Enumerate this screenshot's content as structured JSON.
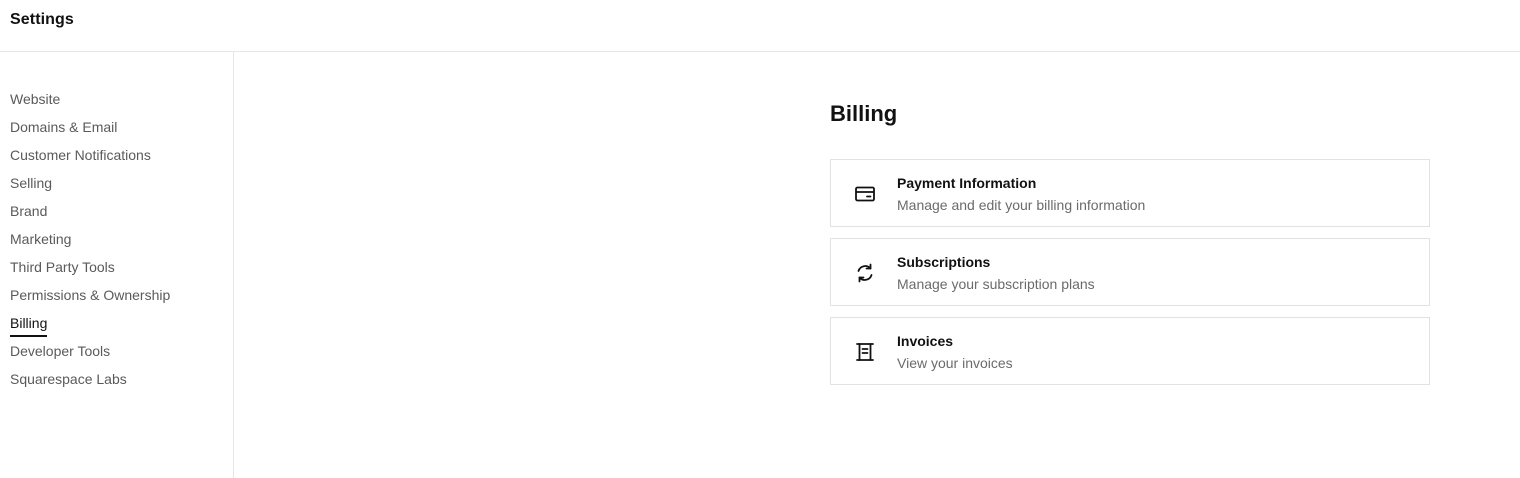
{
  "header": {
    "title": "Settings"
  },
  "sidebar": {
    "items": [
      {
        "label": "Website"
      },
      {
        "label": "Domains & Email"
      },
      {
        "label": "Customer Notifications"
      },
      {
        "label": "Selling"
      },
      {
        "label": "Brand"
      },
      {
        "label": "Marketing"
      },
      {
        "label": "Third Party Tools"
      },
      {
        "label": "Permissions & Ownership"
      },
      {
        "label": "Billing",
        "active": true
      },
      {
        "label": "Developer Tools"
      },
      {
        "label": "Squarespace Labs"
      }
    ]
  },
  "main": {
    "heading": "Billing",
    "cards": [
      {
        "icon": "credit-card-icon",
        "title": "Payment Information",
        "description": "Manage and edit your billing information"
      },
      {
        "icon": "refresh-icon",
        "title": "Subscriptions",
        "description": "Manage your subscription plans"
      },
      {
        "icon": "receipt-icon",
        "title": "Invoices",
        "description": "View your invoices"
      }
    ]
  }
}
